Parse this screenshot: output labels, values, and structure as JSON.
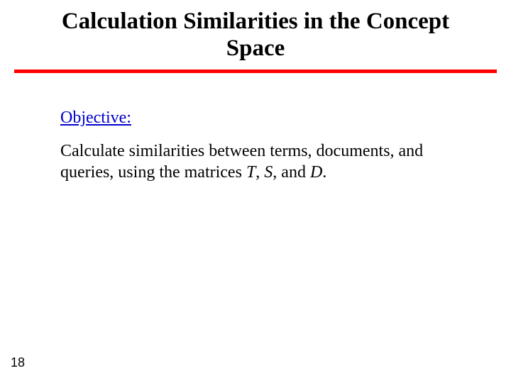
{
  "slide": {
    "title": "Calculation Similarities in the Concept Space",
    "objective_label": "Objective:",
    "body_prefix": "Calculate similarities between terms, documents, and queries, using the matrices ",
    "matrix_T": "T",
    "sep1": ", ",
    "matrix_S": "S",
    "sep2": ", and ",
    "matrix_D": "D",
    "body_suffix": ".",
    "page_number": "18"
  }
}
